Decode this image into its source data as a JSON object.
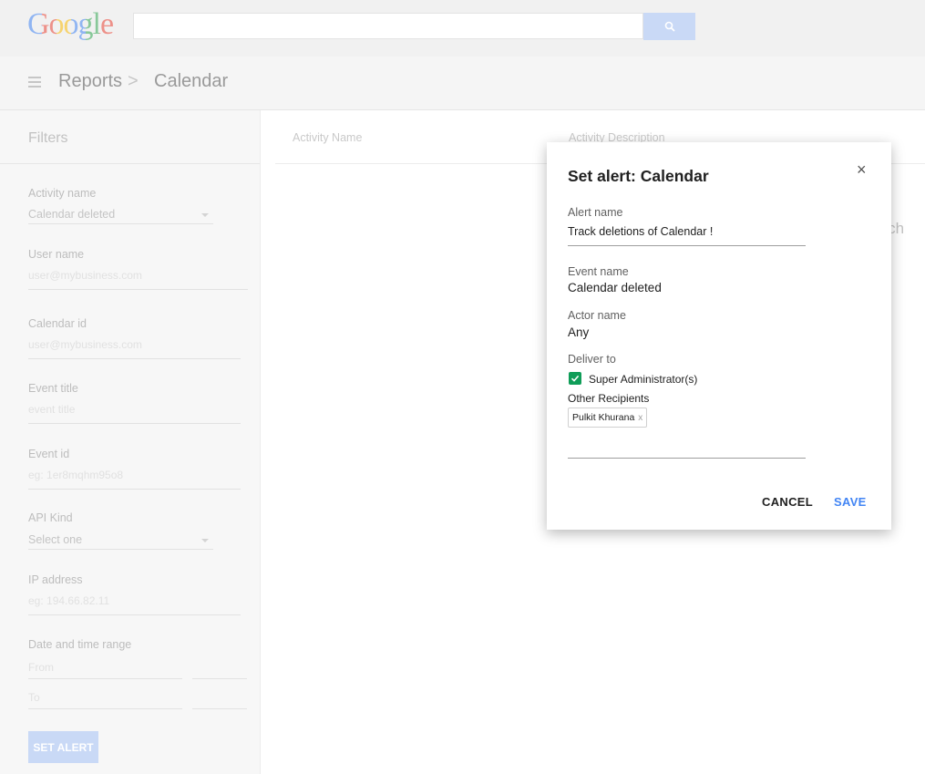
{
  "header": {
    "logo": "Google",
    "search": {
      "placeholder": ""
    },
    "search_icon": "search-icon"
  },
  "breadcrumb": {
    "menu_icon": "menu-icon",
    "items": [
      "Reports",
      "Calendar"
    ],
    "separator": ">"
  },
  "sidebar": {
    "title": "Filters",
    "filters": [
      {
        "label": "Activity name",
        "value": "Calendar deleted",
        "kind": "select"
      },
      {
        "label": "User name",
        "placeholder": "user@mybusiness.com",
        "kind": "text"
      },
      {
        "label": "Calendar id",
        "placeholder": "user@mybusiness.com",
        "kind": "text"
      },
      {
        "label": "Event title",
        "placeholder": "event title",
        "kind": "text"
      },
      {
        "label": "Event id",
        "placeholder": "eg: 1er8mqhm95o8",
        "kind": "text"
      },
      {
        "label": "API Kind",
        "value": "Select one",
        "kind": "select"
      },
      {
        "label": "IP address",
        "placeholder": "eg: 194.66.82.11",
        "kind": "text"
      },
      {
        "label": "Date and time range",
        "from_placeholder": "From",
        "to_placeholder": "To",
        "kind": "range"
      }
    ],
    "set_alert_label": "SET ALERT"
  },
  "table": {
    "columns": [
      "Activity Name",
      "Activity Description"
    ],
    "partial_text": "atch"
  },
  "modal": {
    "title": "Set alert: Calendar",
    "close_label": "×",
    "alert_name_label": "Alert name",
    "alert_name_value": "Track deletions of Calendar !",
    "event_name_label": "Event name",
    "event_name_value": "Calendar deleted",
    "actor_name_label": "Actor name",
    "actor_name_value": "Any",
    "deliver_to_label": "Deliver to",
    "super_admin_label": "Super Administrator(s)",
    "super_admin_checked": true,
    "other_recipients_label": "Other Recipients",
    "recipients": [
      {
        "name": "Pulkit Khurana",
        "remove": "x"
      }
    ],
    "cancel_label": "CANCEL",
    "save_label": "SAVE"
  },
  "colors": {
    "accent": "#4285f4",
    "checkbox": "#0f9d58",
    "disabled_button": "#c9d9f6"
  }
}
